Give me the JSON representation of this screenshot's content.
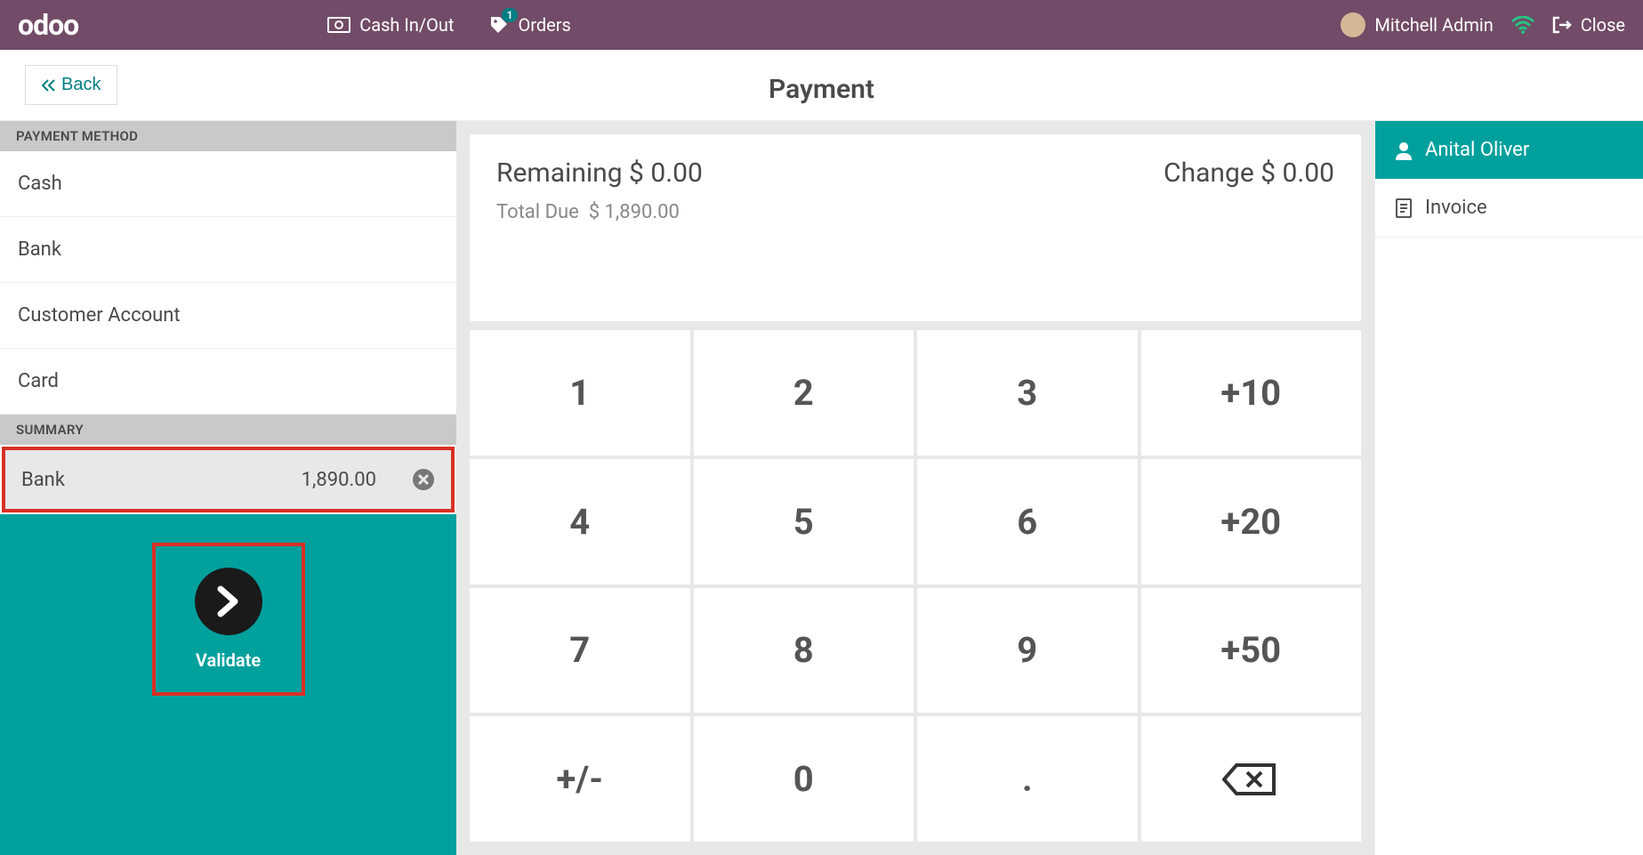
{
  "topbar": {
    "logo": "odoo",
    "cash_label": "Cash In/Out",
    "orders_label": "Orders",
    "orders_badge": "1",
    "user_name": "Mitchell Admin",
    "close_label": "Close"
  },
  "subheader": {
    "back_label": "Back",
    "title": "Payment"
  },
  "left": {
    "pm_header": "PAYMENT METHOD",
    "methods": [
      "Cash",
      "Bank",
      "Customer Account",
      "Card"
    ],
    "summary_header": "SUMMARY",
    "summary_line": {
      "method": "Bank",
      "amount": "1,890.00"
    },
    "validate_label": "Validate"
  },
  "status": {
    "remaining_label": "Remaining",
    "remaining_value": "$ 0.00",
    "change_label": "Change",
    "change_value": "$ 0.00",
    "due_label": "Total Due",
    "due_value": "$ 1,890.00"
  },
  "numpad": {
    "keys": [
      "1",
      "2",
      "3",
      "+10",
      "4",
      "5",
      "6",
      "+20",
      "7",
      "8",
      "9",
      "+50",
      "+/-",
      "0",
      ".",
      "⌫"
    ]
  },
  "right": {
    "customer": "Anital Oliver",
    "invoice_label": "Invoice"
  }
}
